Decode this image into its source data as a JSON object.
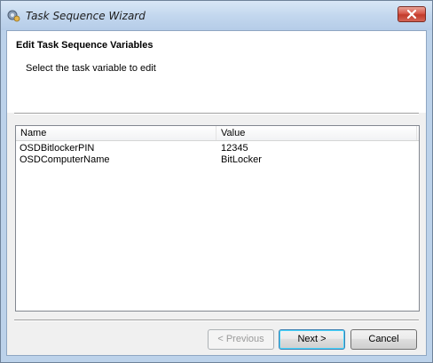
{
  "window": {
    "title": "Task Sequence Wizard"
  },
  "header": {
    "title": "Edit Task Sequence Variables",
    "subtitle": "Select the task variable to edit"
  },
  "list": {
    "columns": [
      "Name",
      "Value"
    ],
    "rows": [
      {
        "name": "OSDBitlockerPIN",
        "value": "12345"
      },
      {
        "name": "OSDComputerName",
        "value": "BitLocker"
      }
    ]
  },
  "buttons": {
    "previous": "< Previous",
    "next": "Next >",
    "cancel": "Cancel"
  },
  "icons": {
    "app": "task-sequence-icon",
    "close": "close-icon"
  }
}
